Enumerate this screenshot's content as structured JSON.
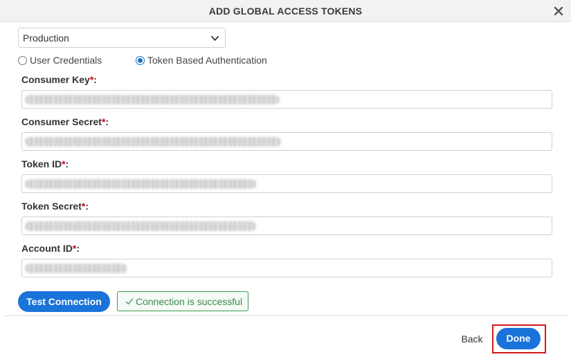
{
  "dialog": {
    "title": "ADD GLOBAL ACCESS TOKENS"
  },
  "environment_select": {
    "value": "Production"
  },
  "auth_options": [
    {
      "label": "User Credentials",
      "selected": false
    },
    {
      "label": "Token Based Authentication",
      "selected": true
    }
  ],
  "fields": {
    "consumer_key": {
      "label": "Consumer Key",
      "required_mark": "*",
      "suffix": ":"
    },
    "consumer_secret": {
      "label": "Consumer Secret",
      "required_mark": "*",
      "suffix": ":"
    },
    "token_id": {
      "label": "Token ID",
      "required_mark": "*",
      "suffix": ":"
    },
    "token_secret": {
      "label": "Token Secret",
      "required_mark": "*",
      "suffix": ":"
    },
    "account_id": {
      "label": "Account ID",
      "required_mark": "*",
      "suffix": ":"
    }
  },
  "actions": {
    "test_connection_label": "Test Connection",
    "connection_status": "Connection is successful",
    "back_label": "Back",
    "done_label": "Done"
  },
  "icons": {
    "close": "close-icon",
    "chevron": "chevron-down-icon",
    "check": "check-icon"
  },
  "colors": {
    "primary": "#1a73d9",
    "success": "#3c9a4c",
    "required": "#d0021b",
    "highlight": "#d0191b"
  }
}
